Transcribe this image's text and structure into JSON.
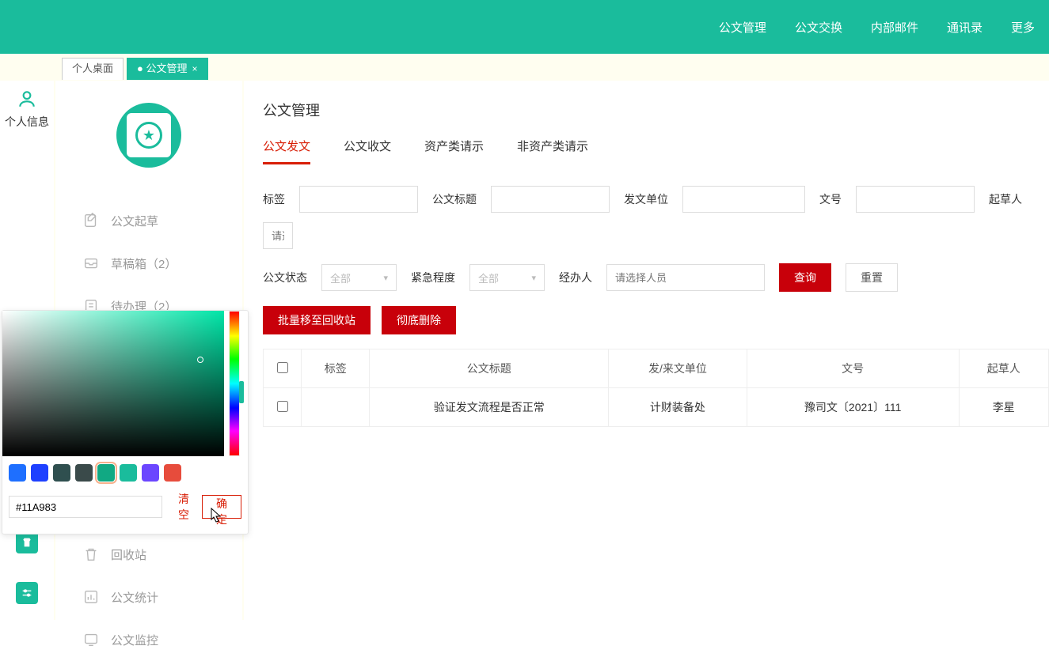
{
  "topnav": {
    "items": [
      "公文管理",
      "公文交换",
      "内部邮件",
      "通讯录",
      "更多"
    ]
  },
  "tabs": {
    "desktop": "个人桌面",
    "active": "公文管理"
  },
  "leftstrip": {
    "label": "个人信息"
  },
  "sidebar": {
    "items": [
      {
        "label": "公文起草"
      },
      {
        "label": "草稿箱（2）"
      },
      {
        "label": "待办理（2）"
      },
      {
        "label": "回收站"
      },
      {
        "label": "公文统计"
      },
      {
        "label": "公文监控"
      }
    ]
  },
  "main": {
    "title": "公文管理",
    "subtabs": [
      "公文发文",
      "公文收文",
      "资产类请示",
      "非资产类请示"
    ],
    "filters": {
      "tag_label": "标签",
      "title_label": "公文标题",
      "unit_label": "发文单位",
      "docno_label": "文号",
      "drafter_label": "起草人",
      "drafter_placeholder": "请选",
      "status_label": "公文状态",
      "status_value": "全部",
      "urgency_label": "紧急程度",
      "urgency_value": "全部",
      "handler_label": "经办人",
      "handler_placeholder": "请选择人员",
      "query_btn": "查询",
      "reset_btn": "重置"
    },
    "actions": {
      "move_recycle": "批量移至回收站",
      "hard_delete": "彻底删除"
    },
    "table": {
      "headers": {
        "tag": "标签",
        "title": "公文标题",
        "unit": "发/来文单位",
        "docno": "文号",
        "drafter": "起草人"
      },
      "rows": [
        {
          "tag": "",
          "title": "验证发文流程是否正常",
          "unit": "计财装备处",
          "docno": "豫司文〔2021〕111",
          "drafter": "李星"
        }
      ]
    }
  },
  "colorpicker": {
    "hex": "#11A983",
    "clear": "清空",
    "ok": "确定",
    "swatches": [
      "#1e6fff",
      "#1e40ff",
      "#2f4f4f",
      "#3a4a4a",
      "#11A983",
      "#1abc9c",
      "#6b46ff",
      "#e74c3c"
    ]
  }
}
